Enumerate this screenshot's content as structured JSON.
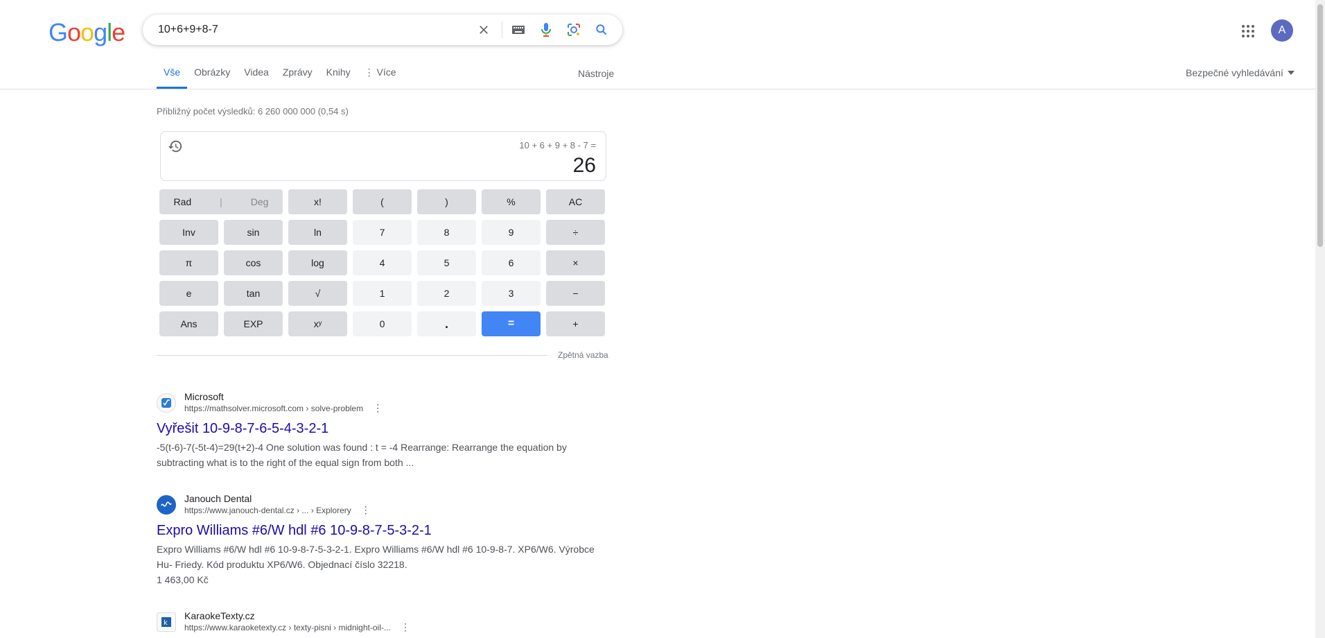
{
  "header": {
    "logo": [
      "G",
      "o",
      "o",
      "g",
      "l",
      "e"
    ],
    "logo_colors": [
      "#4285f4",
      "#ea4335",
      "#fbbc05",
      "#4285f4",
      "#34a853",
      "#ea4335"
    ],
    "query": "10+6+9+8-7",
    "avatar_letter": "A"
  },
  "tabs": [
    {
      "label": "Vše",
      "active": true
    },
    {
      "label": "Obrázky"
    },
    {
      "label": "Videa"
    },
    {
      "label": "Zprávy"
    },
    {
      "label": "Knihy"
    },
    {
      "label": "⋮ Více"
    }
  ],
  "tools_label": "Nástroje",
  "safe_search_label": "Bezpečné vyhledávání",
  "result_stats": "Přibližný počet výsledků: 6 260 000 000 (0,54 s)",
  "calculator": {
    "expression": "10 + 6 + 9 + 8 - 7 =",
    "result": "26",
    "rad": "Rad",
    "deg": "Deg",
    "keys": [
      [
        "",
        "x!",
        "(",
        ")",
        "%",
        "AC"
      ],
      [
        "Inv",
        "sin",
        "ln",
        "7",
        "8",
        "9",
        "÷"
      ],
      [
        "π",
        "cos",
        "log",
        "4",
        "5",
        "6",
        "×"
      ],
      [
        "e",
        "tan",
        "√",
        "1",
        "2",
        "3",
        "−"
      ],
      [
        "Ans",
        "EXP",
        "xʸ",
        "0",
        ".",
        "=",
        "+"
      ]
    ],
    "feedback": "Zpětná vazba"
  },
  "results": [
    {
      "site": "Microsoft",
      "url": "https://mathsolver.microsoft.com › solve-problem",
      "title": "Vyřešit 10-9-8-7-6-5-4-3-2-1",
      "snippet": "-5(t-6)-7(-5t-4)=29(t+2)-4 One solution was found : t = -4 Rearrange: Rearrange the equation by subtracting what is to the right of the equal sign from both ..."
    },
    {
      "site": "Janouch Dental",
      "url": "https://www.janouch-dental.cz › ... › Explorery",
      "title": "Expro Williams #6/W hdl #6 10-9-8-7-5-3-2-1",
      "snippet": "Expro Williams #6/W hdl #6 10-9-8-7-5-3-2-1. Expro Williams #6/W hdl #6 10-9-8-7. XP6/W6. Výrobce Hu- Friedy. Kód produktu XP6/W6. Objednací číslo 32218.",
      "price": "1 463,00 Kč"
    },
    {
      "site": "KaraokeTexty.cz",
      "url": "https://www.karaoketexty.cz › texty-pisni › midnight-oil-..."
    }
  ]
}
